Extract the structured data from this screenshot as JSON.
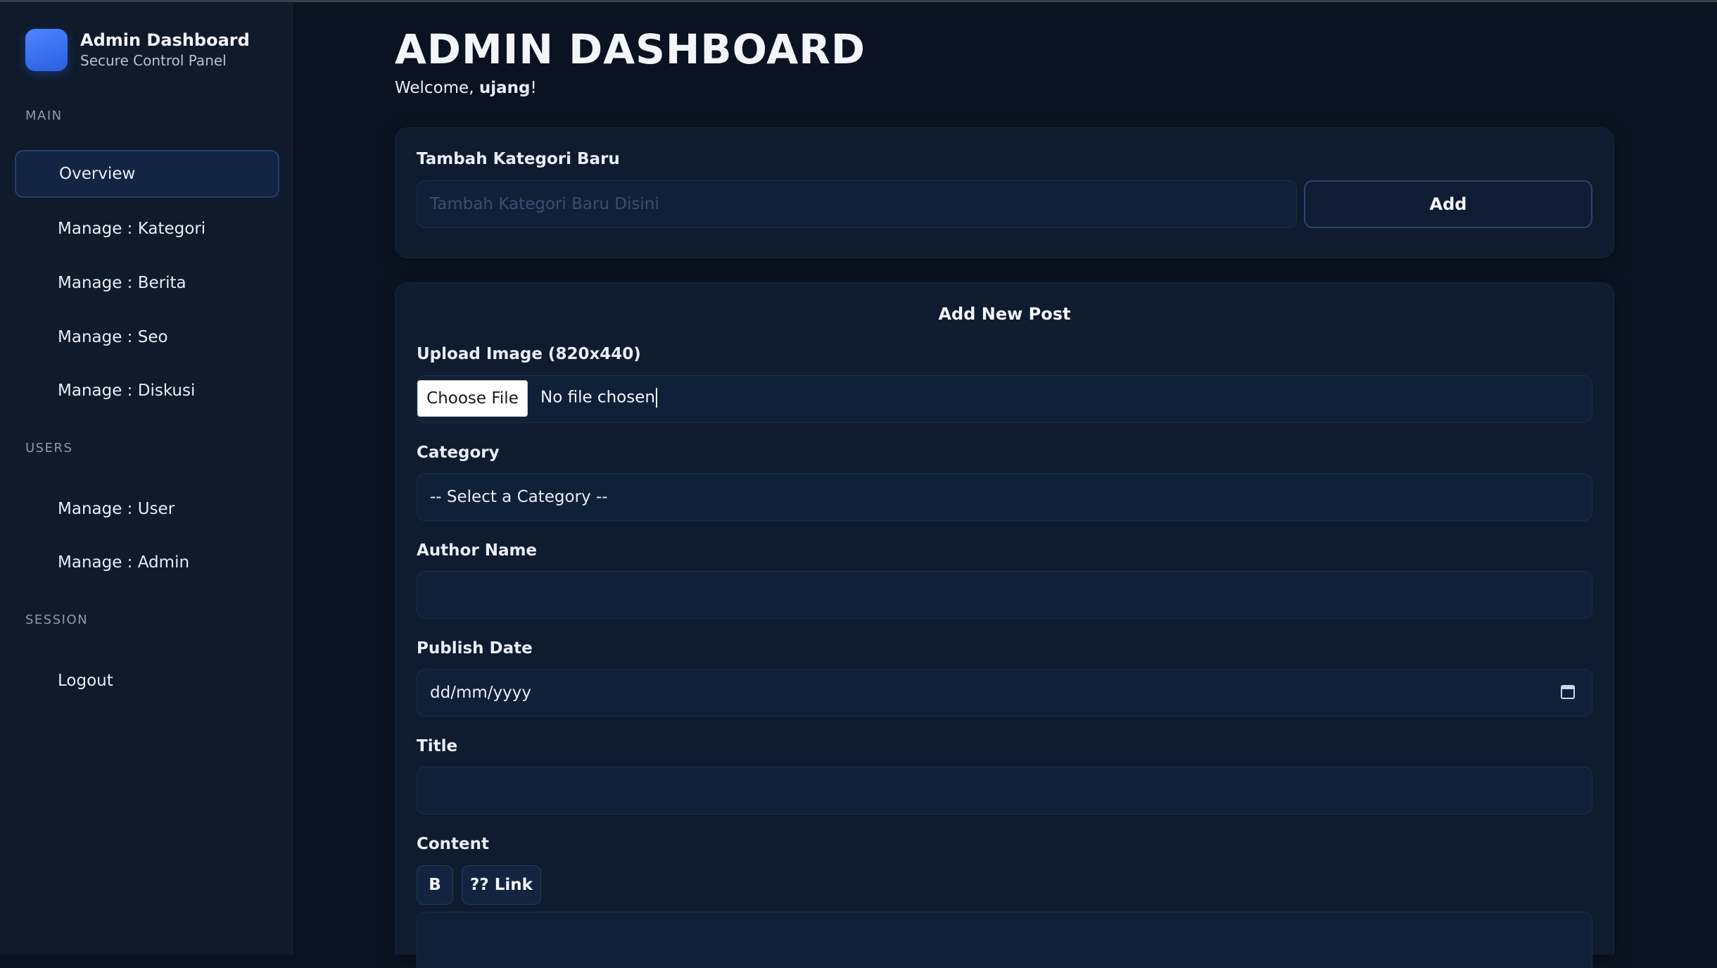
{
  "brand": {
    "title": "Admin Dashboard",
    "subtitle": "Secure Control Panel"
  },
  "sidebar": {
    "sections": [
      {
        "label": "MAIN"
      },
      {
        "label": "USERS"
      },
      {
        "label": "SESSION"
      }
    ],
    "items": [
      {
        "label": "Overview",
        "active": true
      },
      {
        "label": "Manage : Kategori"
      },
      {
        "label": "Manage : Berita"
      },
      {
        "label": "Manage : Seo"
      },
      {
        "label": "Manage : Diskusi"
      },
      {
        "label": "Manage : User"
      },
      {
        "label": "Manage : Admin"
      },
      {
        "label": "Logout"
      }
    ]
  },
  "header": {
    "title": "ADMIN DASHBOARD",
    "welcome_prefix": "Welcome, ",
    "username": "ujang",
    "welcome_suffix": "!"
  },
  "category_form": {
    "heading": "Tambah Kategori Baru",
    "placeholder": "Tambah Kategori Baru Disini",
    "add_label": "Add"
  },
  "post_form": {
    "heading": "Add New Post",
    "upload_label": "Upload Image (820x440)",
    "choose_file_label": "Choose File",
    "file_status": "No file chosen",
    "category_label": "Category",
    "category_selected": "-- Select a Category --",
    "author_label": "Author Name",
    "author_value": "",
    "date_label": "Publish Date",
    "date_placeholder": "dd/mm/yyyy",
    "title_label": "Title",
    "title_value": "",
    "content_label": "Content",
    "toolbar": {
      "bold_label": "B",
      "link_label": "?? Link"
    }
  },
  "colors": {
    "background": "#0b1322",
    "sidebar": "#0f1a2b",
    "card": "#0f1b2f",
    "field": "#112039",
    "accent": "#3b74f2"
  }
}
